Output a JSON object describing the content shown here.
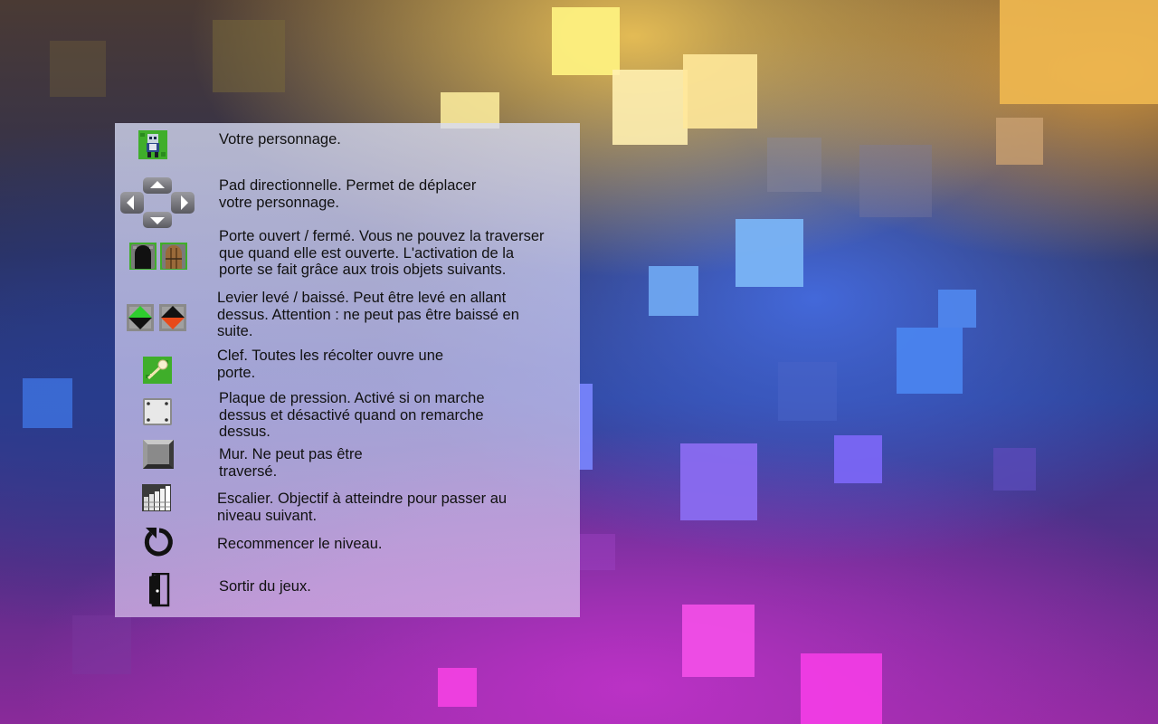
{
  "help_entries": [
    {
      "icon": "character-sprite-icon",
      "text": "Votre personnage."
    },
    {
      "icon": "dpad-icon",
      "text": "Pad directionnelle. Permet de déplacer\nvotre personnage."
    },
    {
      "icon": "door-open-closed-icon",
      "text": "Porte ouvert / fermé. Vous ne pouvez la traverser\nque quand elle est ouverte. L'activation de la\nporte se fait grâce aux trois objets suivants."
    },
    {
      "icon": "lever-up-down-icon",
      "text": "Levier levé / baissé. Peut être levé en allant\ndessus. Attention : ne peut pas être baissé en\nsuite."
    },
    {
      "icon": "key-icon",
      "text": "Clef. Toutes les récolter ouvre une\nporte."
    },
    {
      "icon": "pressure-plate-icon",
      "text": "Plaque de pression. Activé si on marche\ndessus et désactivé quand on remarche\ndessus."
    },
    {
      "icon": "wall-block-icon",
      "text": "Mur. Ne peut pas être\ntraversé."
    },
    {
      "icon": "staircase-icon",
      "text": "Escalier. Objectif à atteindre pour passer au\nniveau suivant."
    },
    {
      "icon": "restart-icon",
      "text": "Recommencer le niveau."
    },
    {
      "icon": "exit-door-icon",
      "text": "Sortir du jeux."
    }
  ],
  "colors": {
    "lever_up": "#2ecc2e",
    "lever_down": "#e84a1a",
    "grass": "#3fae2a"
  }
}
